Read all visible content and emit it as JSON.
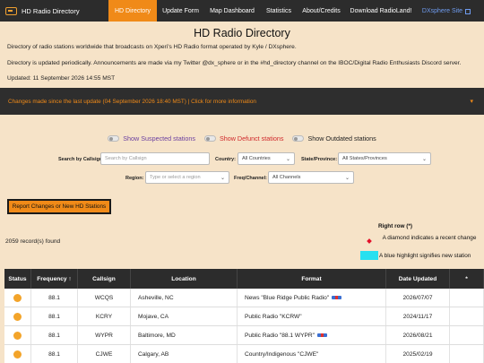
{
  "nav": {
    "brand": "HD Radio Directory",
    "items": [
      {
        "label": "HD Directory",
        "active": true
      },
      {
        "label": "Update Form",
        "active": false
      },
      {
        "label": "Map Dashboard",
        "active": false
      },
      {
        "label": "Statistics",
        "active": false
      },
      {
        "label": "About/Credits",
        "active": false
      },
      {
        "label": "Download RadioLand!",
        "active": false
      },
      {
        "label": "DXsphere Site",
        "active": false
      }
    ]
  },
  "page": {
    "title": "HD Radio Directory",
    "desc1": "Directory of radio stations worldwide that broadcasts on Xperi's HD Radio format operated by Kyle / DXsphere.",
    "desc2": "Directory is updated periodically. Announcements are made via my Twitter @dx_sphere or in the #hd_directory channel on the IBOC/Digital Radio Enthusiasts Discord server.",
    "updated": "Updated: 11 September 2026 14:55 MST"
  },
  "banner": {
    "text": "Changes made since the last update (04 September 2026 18:40 MST) | Click for more information",
    "caret": "▾"
  },
  "toggles": [
    {
      "label": "Show Suspected stations",
      "color": "#6a3fa0"
    },
    {
      "label": "Show Defunct stations",
      "color": "#d0282a"
    },
    {
      "label": "Show Outdated stations",
      "color": "#222222"
    }
  ],
  "search": {
    "callsign_label": "Search by Callsign:",
    "callsign_placeholder": "Search by Callsign",
    "country_label": "Country:",
    "country_value": "All Countries",
    "state_label": "State/Province:",
    "state_value": "All States/Provinces",
    "region_label": "Region:",
    "region_placeholder": "Type or select a region",
    "freq_label": "Freq/Channel:",
    "freq_value": "All Channels"
  },
  "report_button": "Report Changes or New HD Stations",
  "legend": {
    "title": "Right row (*)",
    "diamond_text": "A diamond indicates a recent change",
    "blue_text": "A blue highlight signifies new station"
  },
  "record_count": "2059 record(s) found",
  "table": {
    "headers": [
      "Status",
      "Frequency ↑",
      "Callsign",
      "Location",
      "Format",
      "Date Updated",
      "*"
    ],
    "rows": [
      {
        "freq": "88.1",
        "call": "WCQS",
        "loc": "Asheville, NC",
        "format": "News \"Blue Ridge Public Radio\"",
        "hd": true,
        "date": "2026/07/07"
      },
      {
        "freq": "88.1",
        "call": "KCRY",
        "loc": "Mojave, CA",
        "format": "Public Radio \"KCRW\"",
        "hd": false,
        "date": "2024/11/17"
      },
      {
        "freq": "88.1",
        "call": "WYPR",
        "loc": "Baltimore, MD",
        "format": "Public Radio \"88.1 WYPR\"",
        "hd": true,
        "date": "2026/08/21"
      },
      {
        "freq": "88.1",
        "call": "CJWE",
        "loc": "Calgary, AB",
        "format": "Country/Indigenous \"CJWE\"",
        "hd": false,
        "date": "2025/02/19"
      }
    ]
  }
}
